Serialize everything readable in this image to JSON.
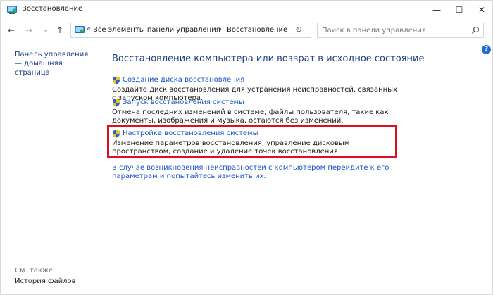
{
  "window": {
    "title": "Восстановление",
    "controls": {
      "minimize": "—",
      "maximize": "☐",
      "close": "✕"
    }
  },
  "nav": {
    "back": "←",
    "forward": "→",
    "up": "↑",
    "breadcrumbs": [
      "Все элементы панели управления",
      "Восстановление"
    ],
    "breadcrumb_separator": "›",
    "root_separator": "«",
    "dropdown": "⌄",
    "refresh": "↻",
    "search_placeholder": "Поиск в панели управления"
  },
  "sidebar": {
    "home_link": "Панель управления — домашняя страница",
    "see_also": "См. также",
    "history_link": "История файлов"
  },
  "help": "?",
  "main": {
    "title": "Восстановление компьютера или возврат в исходное состояние",
    "tasks": [
      {
        "link": "Создание диска восстановления",
        "desc": "Создайте диск восстановления для устранения неисправностей, связанных с запуском компьютера."
      },
      {
        "link": "Запуск восстановления системы",
        "desc": "Отмена последних изменений в системе; файлы пользователя, такие как документы, изображения и музыка, остаются без изменений."
      },
      {
        "link": "Настройка восстановления системы",
        "desc": "Изменение параметров восстановления, управление дисковым пространством, создание и удаление точек восстановления."
      }
    ],
    "trouble_link": "В случае возникновения неисправностей с компьютером перейдите к его параметрам и попытайтесь изменить их."
  },
  "colors": {
    "link": "#1a56c4",
    "title": "#1e3f7a",
    "highlight": "#e00f1e"
  }
}
